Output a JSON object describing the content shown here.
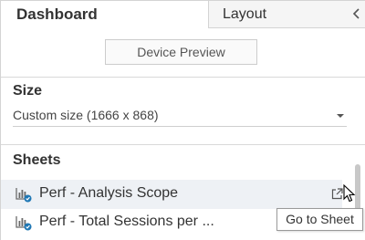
{
  "tabs": {
    "dashboard_label": "Dashboard",
    "layout_label": "Layout"
  },
  "preview": {
    "button_label": "Device Preview"
  },
  "size": {
    "title": "Size",
    "selected_value": "Custom size (1666 x 868)"
  },
  "sheets": {
    "title": "Sheets",
    "items": [
      {
        "label": "Perf - Analysis Scope",
        "icon": "worksheet-icon"
      },
      {
        "label": "Perf - Total Sessions per ...",
        "icon": "worksheet-icon"
      }
    ],
    "goto_icon": "external-link-icon",
    "tooltip": "Go to Sheet"
  },
  "colors": {
    "hover_row": "#eef1f5",
    "icon_badge": "#1f77b4",
    "border": "#d4d4d4"
  }
}
